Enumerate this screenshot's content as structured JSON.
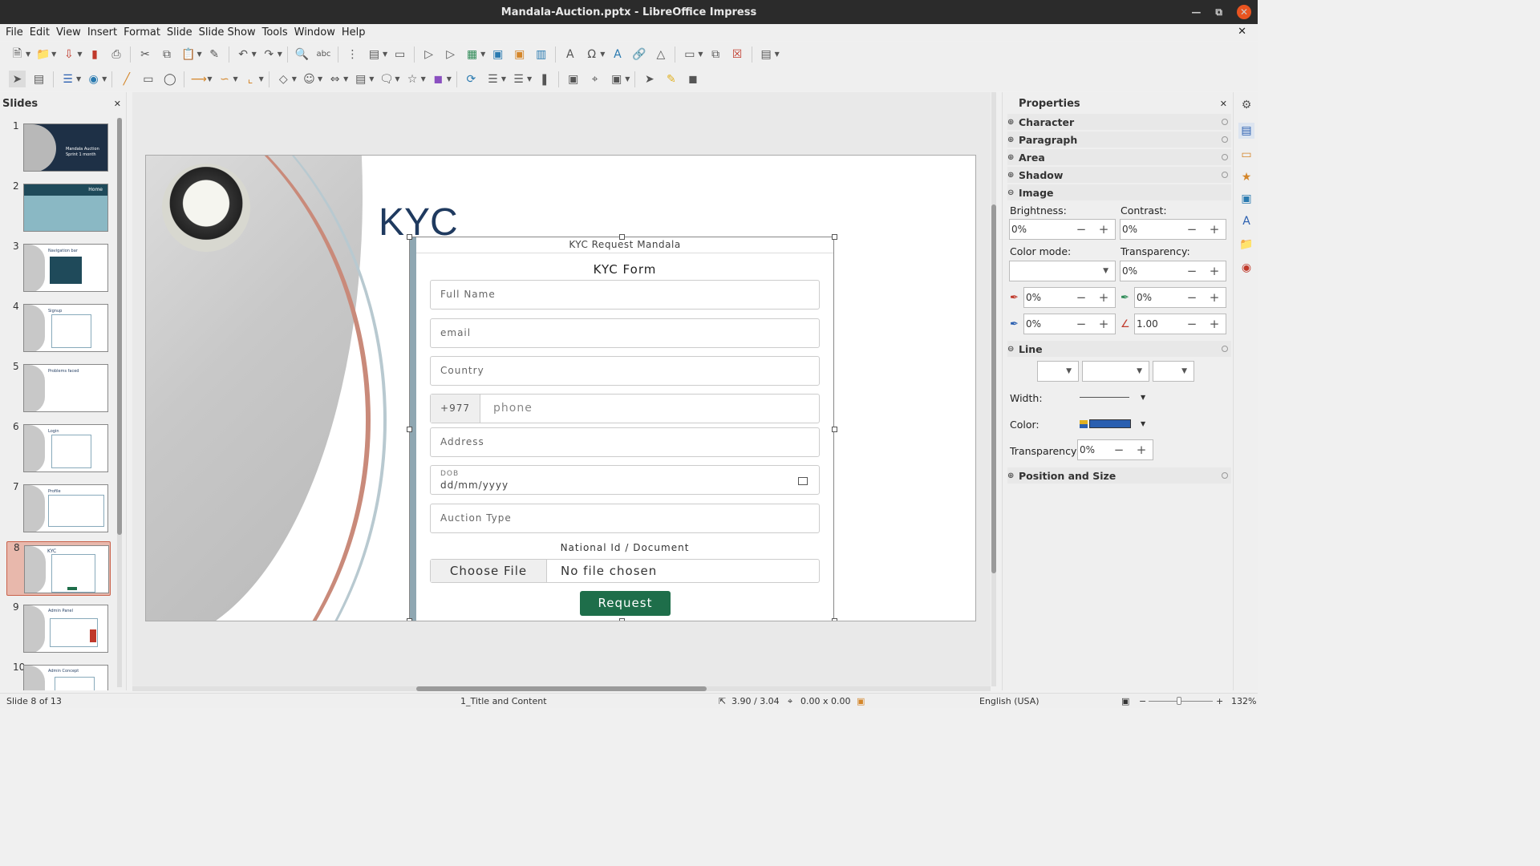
{
  "window": {
    "title": "Mandala-Auction.pptx - LibreOffice Impress"
  },
  "menu": [
    "File",
    "Edit",
    "View",
    "Insert",
    "Format",
    "Slide",
    "Slide Show",
    "Tools",
    "Window",
    "Help"
  ],
  "slides_panel": {
    "title": "Slides",
    "thumbnails": [
      {
        "num": "1",
        "caption": "Mandala Auction Sprint 1 month"
      },
      {
        "num": "2",
        "caption": "Home"
      },
      {
        "num": "3",
        "caption": "Navigation bar"
      },
      {
        "num": "4",
        "caption": "Signup"
      },
      {
        "num": "5",
        "caption": "Problems faced"
      },
      {
        "num": "6",
        "caption": "Login"
      },
      {
        "num": "7",
        "caption": "Profile"
      },
      {
        "num": "8",
        "caption": "KYC"
      },
      {
        "num": "9",
        "caption": "Admin Panel"
      },
      {
        "num": "10",
        "caption": "Admin Concept"
      }
    ],
    "selected": 8
  },
  "slide": {
    "title": "KYC",
    "form": {
      "header": "KYC Request Mandala",
      "title": "KYC Form",
      "full_name_placeholder": "Full Name",
      "email_placeholder": "email",
      "country_placeholder": "Country",
      "phone_prefix": "+977",
      "phone_placeholder": "phone",
      "address_placeholder": "Address",
      "dob_label": "DOB",
      "dob_placeholder": "dd/mm/yyyy",
      "auction_type_placeholder": "Auction Type",
      "document_label": "National Id / Document",
      "choose_file": "Choose File",
      "no_file": "No file chosen",
      "request_button": "Request"
    }
  },
  "properties": {
    "title": "Properties",
    "sections": {
      "character": "Character",
      "paragraph": "Paragraph",
      "area": "Area",
      "shadow": "Shadow",
      "image": "Image",
      "line": "Line",
      "position_size": "Position and Size"
    },
    "image": {
      "brightness_label": "Brightness:",
      "brightness": "0%",
      "contrast_label": "Contrast:",
      "contrast": "0%",
      "color_mode_label": "Color mode:",
      "color_mode": "",
      "transparency_label": "Transparency:",
      "transparency": "0%",
      "red": "0%",
      "green": "0%",
      "blue": "0%",
      "gamma": "1.00"
    },
    "line": {
      "width_label": "Width:",
      "color_label": "Color:",
      "color": "#2a5fb0",
      "transparency_label": "Transparency:",
      "transparency": "0%"
    }
  },
  "status": {
    "slide_info": "Slide 8 of 13",
    "layout": "1_Title and Content",
    "position": "3.90 / 3.04",
    "size": "0.00 x 0.00",
    "language": "English (USA)",
    "zoom": "132%"
  },
  "colors": {
    "accent": "#e95420",
    "selection": "#e8b8ac",
    "request_button": "#1e6e4a"
  }
}
